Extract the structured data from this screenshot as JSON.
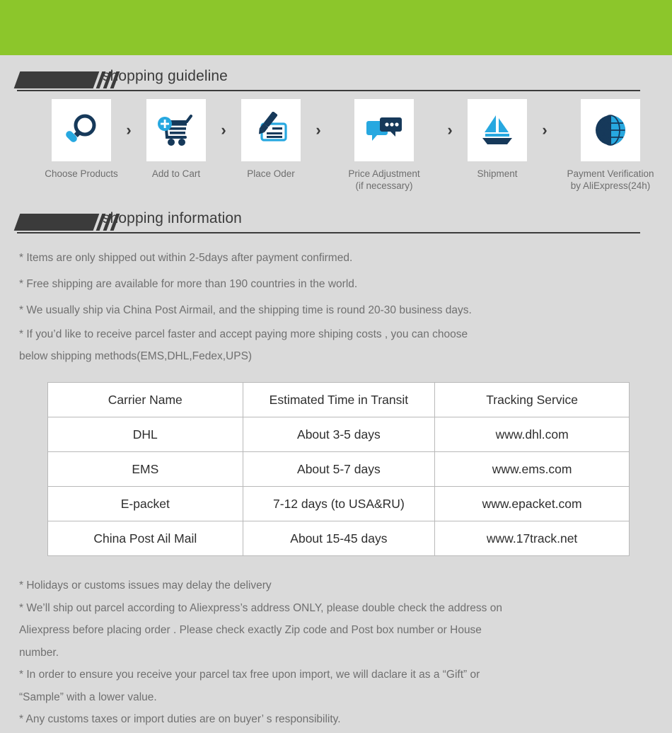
{
  "theme": {
    "banner_color": "#8cc62b",
    "background_color": "#dadada",
    "heading_color": "#3b3b3b",
    "body_text_color": "#707070",
    "table_text_color": "#2e2e2e",
    "icon_dark": "#16395a",
    "icon_accent": "#27a8e0"
  },
  "sections": {
    "guideline": {
      "title": "shopping guideline",
      "steps": [
        {
          "icon": "magnifier-icon",
          "label": "Choose Products"
        },
        {
          "icon": "add-to-cart-icon",
          "label": "Add to Cart"
        },
        {
          "icon": "pen-form-icon",
          "label": "Place Oder"
        },
        {
          "icon": "chat-bubbles-icon",
          "label": "Price Adjustment\n(if necessary)"
        },
        {
          "icon": "sailboat-icon",
          "label": "Shipment"
        },
        {
          "icon": "dollar-globe-icon",
          "label": "Payment Verification\nby AliExpress(24h)"
        }
      ],
      "separator": "›"
    },
    "information": {
      "title": "shopping information",
      "notes_top": [
        "* Items are only shipped out within 2-5days after payment confirmed.",
        "* Free shipping are available for more than 190 countries in the world.",
        "* We usually ship via China Post Airmail, and the shipping time is round 20-30 business days.",
        "* If you’d like to receive parcel faster and accept paying more shiping costs , you can choose\n   below shipping methods(EMS,DHL,Fedex,UPS)"
      ],
      "table": {
        "headers": [
          "Carrier Name",
          "Estimated Time in Transit",
          "Tracking Service"
        ],
        "rows": [
          [
            "DHL",
            "About 3-5 days",
            "www.dhl.com"
          ],
          [
            "EMS",
            "About 5-7 days",
            "www.ems.com"
          ],
          [
            "E-packet",
            "7-12 days (to USA&RU)",
            "www.epacket.com"
          ],
          [
            "China Post Ail Mail",
            "About 15-45 days",
            "www.17track.net"
          ]
        ]
      },
      "notes_bottom": [
        "* Holidays or customs issues may delay the delivery",
        "* We’ll ship out parcel according to Aliexpress’s address ONLY, please double check the address on\n   Aliexpress before placing order . Please check exactly Zip code and Post box  number or House\n   number.",
        "* In order to ensure you receive your parcel tax free upon import, we will daclare it as a  “Gift”  or\n   “Sample”  with a lower value.",
        "* Any customs taxes or import duties are on buyer’ s responsibility."
      ]
    }
  }
}
